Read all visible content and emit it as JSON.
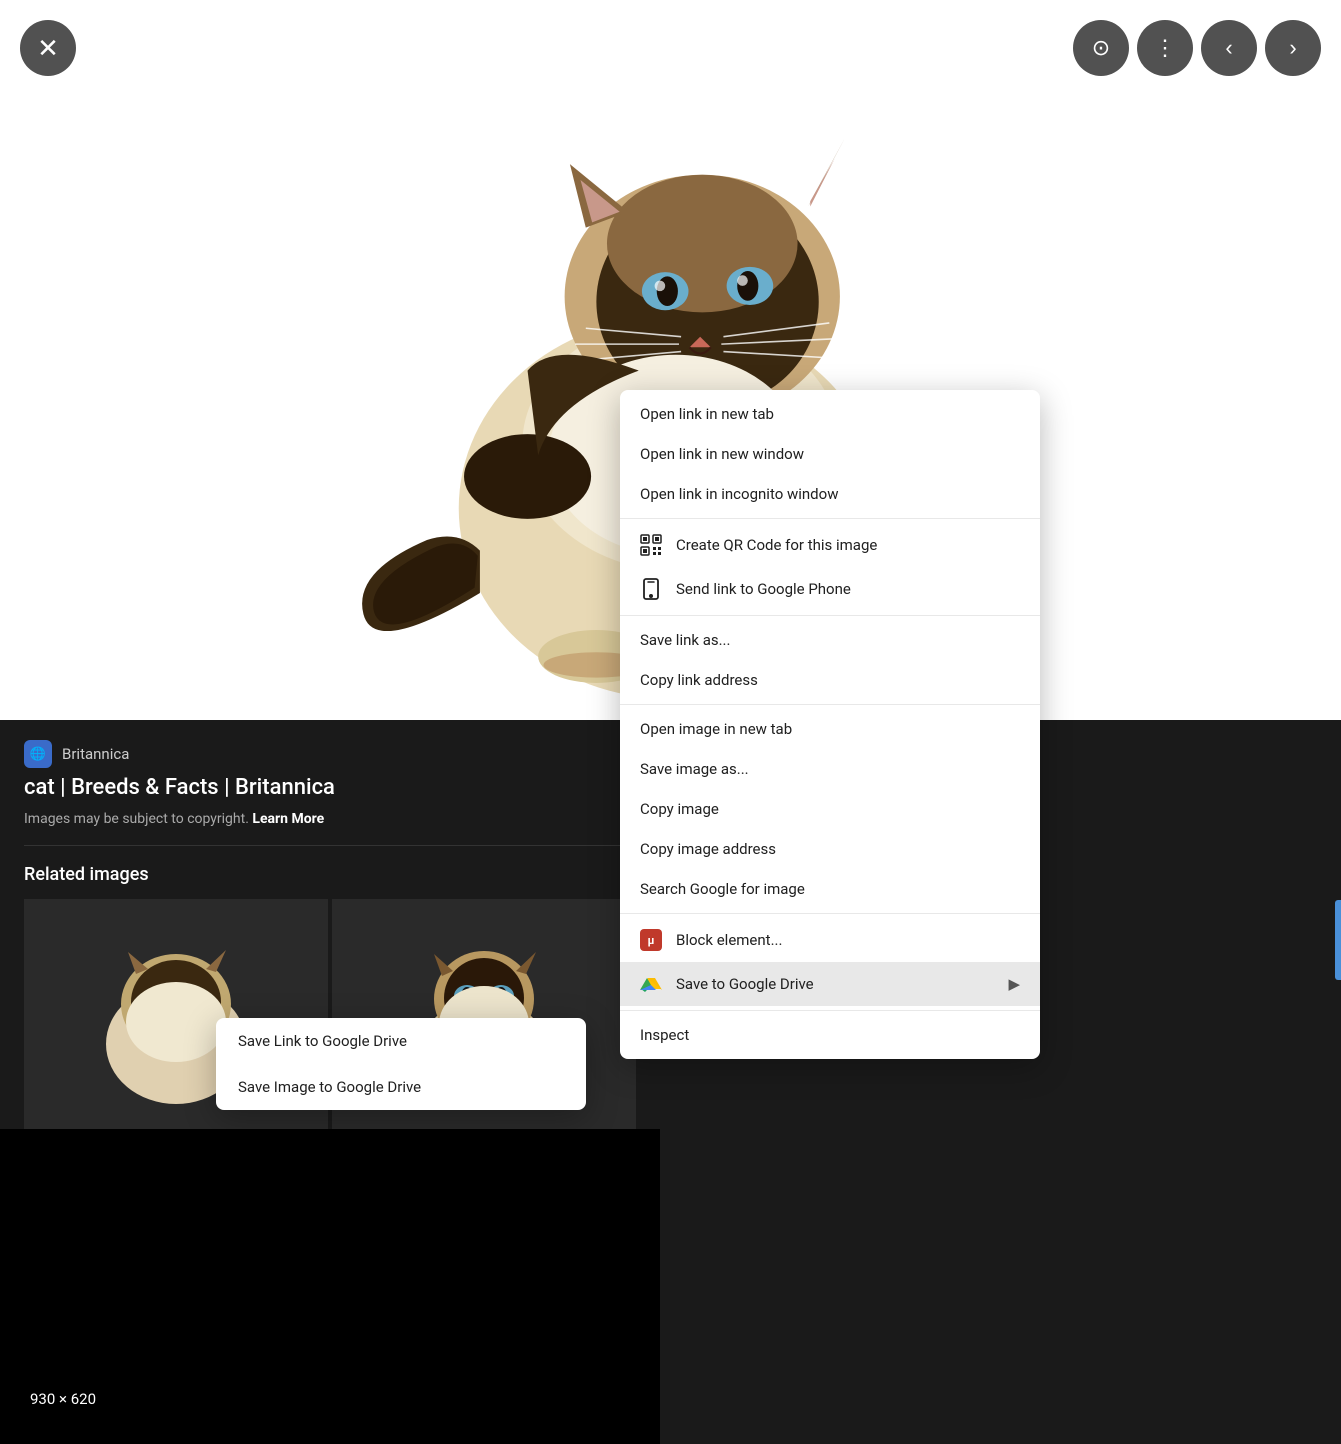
{
  "viewer": {
    "dimensions": "930 × 620",
    "close_label": "✕"
  },
  "toolbar": {
    "lens_icon": "⊙",
    "more_icon": "⋮",
    "back_icon": "‹",
    "forward_icon": "›"
  },
  "info_panel": {
    "source": "Britannica",
    "title": "cat | Breeds & Facts | Britannica",
    "copyright": "Images may be subject to copyright.",
    "learn_more": "Learn More",
    "related_heading": "Related images"
  },
  "context_menu": {
    "items": [
      {
        "id": "open-new-tab",
        "label": "Open link in new tab",
        "icon": null,
        "section": 1
      },
      {
        "id": "open-new-window",
        "label": "Open link in new window",
        "icon": null,
        "section": 1
      },
      {
        "id": "open-incognito",
        "label": "Open link in incognito window",
        "icon": null,
        "section": 1
      },
      {
        "id": "create-qr",
        "label": "Create QR Code for this image",
        "icon": "qr",
        "section": 2
      },
      {
        "id": "send-phone",
        "label": "Send link to Google Phone",
        "icon": "phone",
        "section": 2
      },
      {
        "id": "save-link-as",
        "label": "Save link as...",
        "icon": null,
        "section": 3
      },
      {
        "id": "copy-link-address",
        "label": "Copy link address",
        "icon": null,
        "section": 3
      },
      {
        "id": "open-image-new-tab",
        "label": "Open image in new tab",
        "icon": null,
        "section": 4
      },
      {
        "id": "save-image-as",
        "label": "Save image as...",
        "icon": null,
        "section": 4
      },
      {
        "id": "copy-image",
        "label": "Copy image",
        "icon": null,
        "section": 4
      },
      {
        "id": "copy-image-address",
        "label": "Copy image address",
        "icon": null,
        "section": 4
      },
      {
        "id": "search-google-image",
        "label": "Search Google for image",
        "icon": null,
        "section": 4
      },
      {
        "id": "block-element",
        "label": "Block element...",
        "icon": "ublock",
        "section": 5
      },
      {
        "id": "save-google-drive",
        "label": "Save to Google Drive",
        "icon": "gdrive",
        "section": 5,
        "has_arrow": true
      },
      {
        "id": "inspect",
        "label": "Inspect",
        "icon": null,
        "section": 6
      }
    ]
  },
  "sub_menu": {
    "items": [
      {
        "id": "save-link-drive",
        "label": "Save Link to Google Drive"
      },
      {
        "id": "save-image-drive",
        "label": "Save Image to Google Drive"
      }
    ]
  }
}
